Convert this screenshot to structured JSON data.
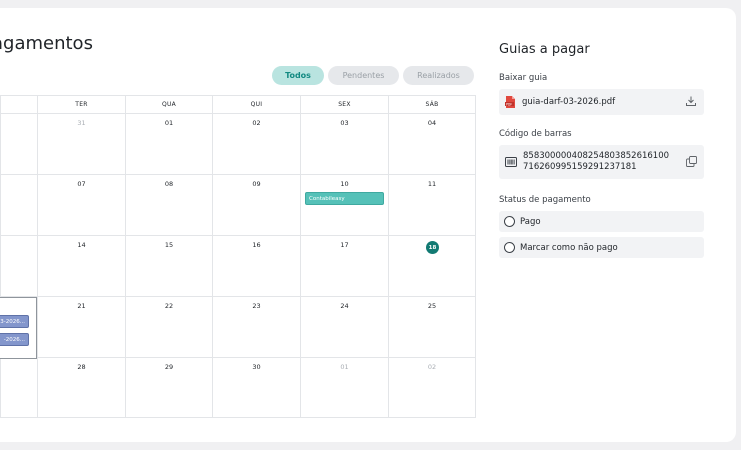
{
  "page": {
    "title": "agamentos"
  },
  "filters": [
    {
      "label": "Todos",
      "active": true
    },
    {
      "label": "Pendentes",
      "active": false
    },
    {
      "label": "Realizados",
      "active": false
    }
  ],
  "calendar": {
    "weekdays": [
      "",
      "TER",
      "QUA",
      "QUI",
      "SEX",
      "SÁB"
    ],
    "weeks": [
      {
        "days": [
          {
            "label": "",
            "muted": false
          },
          {
            "label": "31",
            "muted": true
          },
          {
            "label": "01",
            "muted": false
          },
          {
            "label": "02",
            "muted": false
          },
          {
            "label": "03",
            "muted": false
          },
          {
            "label": "04",
            "muted": false
          }
        ]
      },
      {
        "days": [
          {
            "label": "",
            "muted": false
          },
          {
            "label": "07",
            "muted": false
          },
          {
            "label": "08",
            "muted": false
          },
          {
            "label": "09",
            "muted": false
          },
          {
            "label": "10",
            "muted": false,
            "event": "Contabileasy"
          },
          {
            "label": "11",
            "muted": false
          }
        ]
      },
      {
        "days": [
          {
            "label": "",
            "muted": false
          },
          {
            "label": "14",
            "muted": false
          },
          {
            "label": "15",
            "muted": false
          },
          {
            "label": "16",
            "muted": false
          },
          {
            "label": "17",
            "muted": false
          },
          {
            "label": "18",
            "muted": false,
            "today": true
          }
        ]
      },
      {
        "days": [
          {
            "label": "",
            "muted": false
          },
          {
            "label": "21",
            "muted": false
          },
          {
            "label": "22",
            "muted": false
          },
          {
            "label": "23",
            "muted": false
          },
          {
            "label": "24",
            "muted": false
          },
          {
            "label": "25",
            "muted": false
          }
        ]
      },
      {
        "days": [
          {
            "label": "",
            "muted": false
          },
          {
            "label": "28",
            "muted": false
          },
          {
            "label": "29",
            "muted": false
          },
          {
            "label": "30",
            "muted": false
          },
          {
            "label": "01",
            "muted": true
          },
          {
            "label": "02",
            "muted": true
          }
        ]
      }
    ],
    "selected_events": [
      "3-2026...",
      "-2026..."
    ]
  },
  "panel": {
    "title": "Guias a pagar",
    "download_label": "Baixar guia",
    "file_name": "guia-darf-03-2026.pdf",
    "barcode_label": "Código de barras",
    "barcode_line1": "858300000408254803852616100",
    "barcode_line2": "716260995159291237181",
    "status_label": "Status de pagamento",
    "option_paid": "Pago",
    "option_unpaid": "Marcar como não pago"
  },
  "icons": {
    "pdf": "pdf-file-icon",
    "download": "download-icon",
    "barcode": "barcode-icon",
    "copy": "copy-icon"
  },
  "colors": {
    "accent": "#127a73",
    "event_teal": "#55c1b8",
    "event_blue": "#8396cc",
    "pdf_red": "#e0483e"
  }
}
